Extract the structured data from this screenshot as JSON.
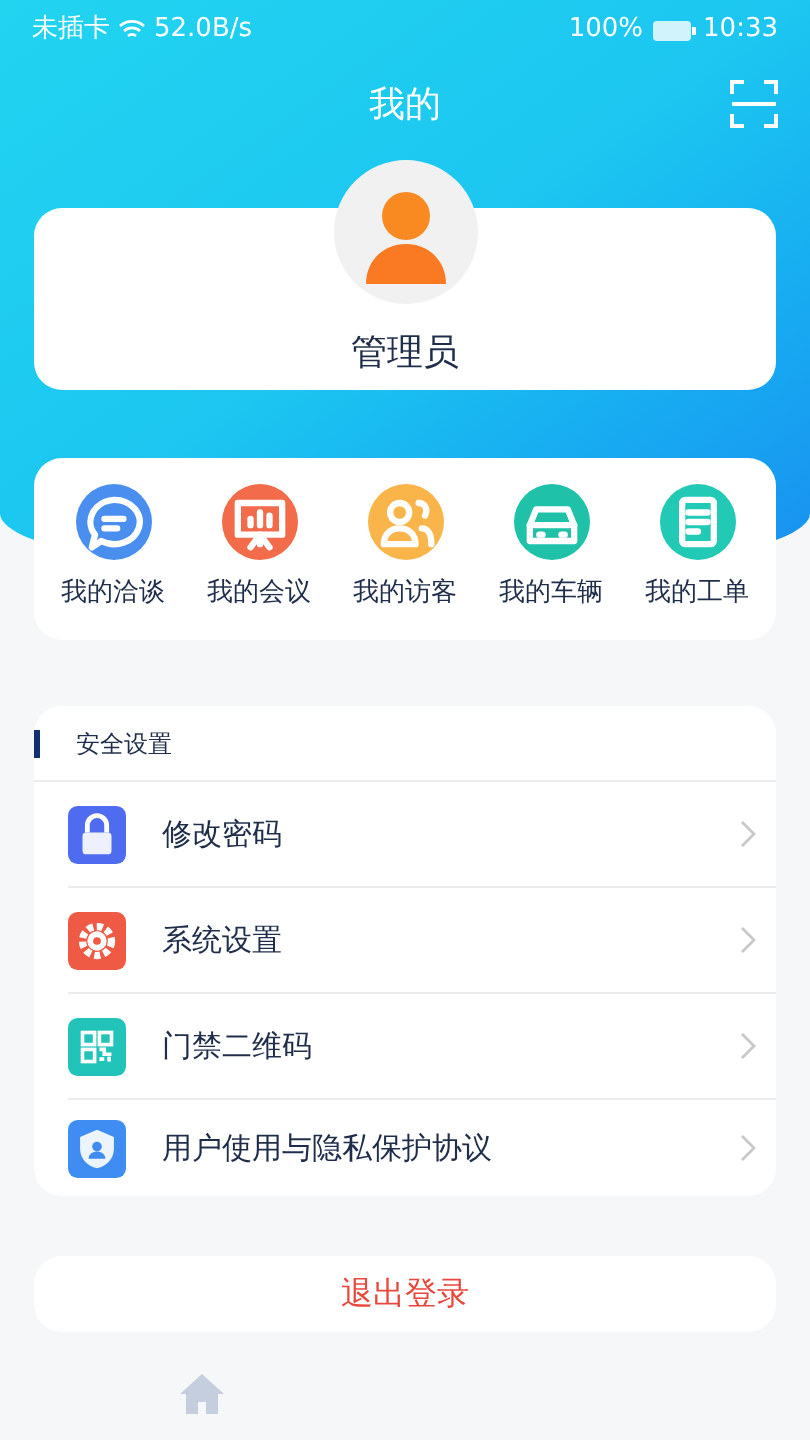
{
  "status_bar": {
    "carrier": "未插卡",
    "speed": "52.0B/s",
    "battery": "100%",
    "time": "10:33"
  },
  "header": {
    "title": "我的"
  },
  "profile": {
    "name": "管理员"
  },
  "shortcuts": [
    {
      "label": "我的洽谈",
      "kind": "chat",
      "color": "#4a8ef0"
    },
    {
      "label": "我的会议",
      "kind": "meeting",
      "color": "#f26b4a"
    },
    {
      "label": "我的访客",
      "kind": "visitor",
      "color": "#f9b54a"
    },
    {
      "label": "我的车辆",
      "kind": "car",
      "color": "#1fc2a8"
    },
    {
      "label": "我的工单",
      "kind": "order",
      "color": "#22c9b4"
    }
  ],
  "settings": {
    "title": "安全设置",
    "items": [
      {
        "label": "修改密码",
        "kind": "lock",
        "color": "#4f6cf0"
      },
      {
        "label": "系统设置",
        "kind": "gear",
        "color": "#ef5a45"
      },
      {
        "label": "门禁二维码",
        "kind": "qr",
        "color": "#22c3b8"
      },
      {
        "label": "用户使用与隐私保护协议",
        "kind": "shield",
        "color": "#3f8cf2"
      }
    ]
  },
  "logout": {
    "label": "退出登录"
  }
}
